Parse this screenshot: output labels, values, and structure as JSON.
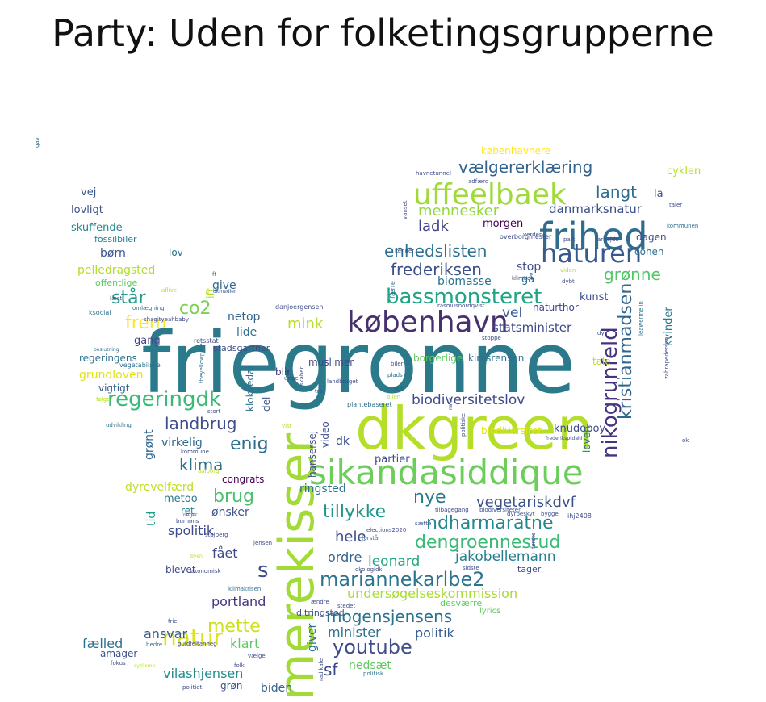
{
  "title": "Party: Uden for folketingsgrupperne",
  "words": [
    {
      "text": "friegronne",
      "color": "#2b7a8c"
    },
    {
      "text": "dkgreen",
      "color": "#b5de2b"
    },
    {
      "text": "sikandasiddique",
      "color": "#6ccd5a"
    },
    {
      "text": "merekisser",
      "color": "#a2da37"
    },
    {
      "text": "frihed",
      "color": "#2f6c8e"
    },
    {
      "text": "uffeelbaek",
      "color": "#9fda3a"
    },
    {
      "text": "københavn",
      "color": "#46306f"
    },
    {
      "text": "naturen",
      "color": "#38598c"
    },
    {
      "text": "regeringdk",
      "color": "#3aba76"
    },
    {
      "text": "natur",
      "color": "#dde318"
    },
    {
      "text": "bassmonsteret",
      "color": "#20a486"
    },
    {
      "text": "nikogrunfeld",
      "color": "#46337e"
    },
    {
      "text": "kristianmadsen",
      "color": "#31668e"
    },
    {
      "text": "youtube",
      "color": "#3e4c8a"
    },
    {
      "text": "mariannekarlbe2",
      "color": "#2c738e"
    },
    {
      "text": "dengroennestud",
      "color": "#3aba76"
    },
    {
      "text": "ndharmaratne",
      "color": "#24868e"
    },
    {
      "text": "tillykke",
      "color": "#1f968b"
    },
    {
      "text": "nye",
      "color": "#2a788e"
    },
    {
      "text": "vegetariskdvf",
      "color": "#3b528b"
    },
    {
      "text": "biodiversitetslov",
      "color": "#3e4a89"
    },
    {
      "text": "enhedslisten",
      "color": "#2c718e"
    },
    {
      "text": "frederiksen",
      "color": "#3c4f8a"
    },
    {
      "text": "grønne",
      "color": "#54c568"
    },
    {
      "text": "mennesker",
      "color": "#95d840"
    },
    {
      "text": "ladk",
      "color": "#414487"
    },
    {
      "text": "langt",
      "color": "#2e6d8e"
    },
    {
      "text": "vælgererklæring",
      "color": "#33628d"
    },
    {
      "text": "danmarksnatur",
      "color": "#3b518b"
    },
    {
      "text": "mink",
      "color": "#b8de29"
    },
    {
      "text": "co2",
      "color": "#7ad151"
    },
    {
      "text": "står",
      "color": "#1e9c89"
    },
    {
      "text": "frem",
      "color": "#fde725"
    },
    {
      "text": "mette",
      "color": "#cde11d"
    },
    {
      "text": "brug",
      "color": "#4ac16d"
    },
    {
      "text": "enig",
      "color": "#2e6e8e"
    },
    {
      "text": "klima",
      "color": "#2c728e"
    },
    {
      "text": "landbrug",
      "color": "#3d4e8a"
    },
    {
      "text": "s",
      "color": "#3e4a89"
    },
    {
      "text": "mogensjensens",
      "color": "#2c728e"
    },
    {
      "text": "hele",
      "color": "#3e4c8a"
    },
    {
      "text": "leonard",
      "color": "#21a685"
    },
    {
      "text": "jakobellemann",
      "color": "#277f8e"
    },
    {
      "text": "undersøgelseskommission",
      "color": "#a8db34"
    },
    {
      "text": "portland",
      "color": "#46337e"
    },
    {
      "text": "minister",
      "color": "#2d708e"
    },
    {
      "text": "politik",
      "color": "#365d8d"
    },
    {
      "text": "sf",
      "color": "#3f4889"
    },
    {
      "text": "nedsæt",
      "color": "#60ca60"
    },
    {
      "text": "ansvar",
      "color": "#375a8c"
    },
    {
      "text": "fælled",
      "color": "#2d718e"
    },
    {
      "text": "klart",
      "color": "#5ec962"
    },
    {
      "text": "vilashjensen",
      "color": "#228c8d"
    },
    {
      "text": "biden",
      "color": "#33638d"
    },
    {
      "text": "grøn",
      "color": "#3b518b"
    },
    {
      "text": "spolitik",
      "color": "#3e4a89"
    },
    {
      "text": "fået",
      "color": "#3f4889"
    },
    {
      "text": "blevet",
      "color": "#3e4c8a"
    },
    {
      "text": "ordre",
      "color": "#33638d"
    },
    {
      "text": "ringsted",
      "color": "#2d708e"
    },
    {
      "text": "dyrevelfærd",
      "color": "#bddf26"
    },
    {
      "text": "metoo",
      "color": "#2a788e"
    },
    {
      "text": "ønsker",
      "color": "#3b528b"
    },
    {
      "text": "ret",
      "color": "#26828e"
    },
    {
      "text": "tid",
      "color": "#1e9b8a"
    },
    {
      "text": "virkelig",
      "color": "#2f6b8e"
    },
    {
      "text": "grønt",
      "color": "#31688e"
    },
    {
      "text": "grundloven",
      "color": "#dfe318"
    },
    {
      "text": "gang",
      "color": "#414487"
    },
    {
      "text": "lide",
      "color": "#2e6f8e"
    },
    {
      "text": "netop",
      "color": "#33638d"
    },
    {
      "text": "give",
      "color": "#30698e"
    },
    {
      "text": "pelledragsted",
      "color": "#b2dd2d"
    },
    {
      "text": "børn",
      "color": "#3a548c"
    },
    {
      "text": "skuffende",
      "color": "#24878e"
    },
    {
      "text": "lovligt",
      "color": "#3b518b"
    },
    {
      "text": "vej",
      "color": "#38598c"
    },
    {
      "text": "lov",
      "color": "#2c728e"
    },
    {
      "text": "fossilbiler",
      "color": "#25848e"
    },
    {
      "text": "offentlige",
      "color": "#5ec962"
    },
    {
      "text": "regeringens",
      "color": "#2d708e"
    },
    {
      "text": "vigtigt",
      "color": "#365d8d"
    },
    {
      "text": "kvinder",
      "color": "#2a788e"
    },
    {
      "text": "kunst",
      "color": "#3b528b"
    },
    {
      "text": "tale",
      "color": "#bddf26"
    },
    {
      "text": "vel",
      "color": "#365d8d"
    },
    {
      "text": "naturthor",
      "color": "#3f4889"
    },
    {
      "text": "statsminister",
      "color": "#3e4a89"
    },
    {
      "text": "kirksrensen",
      "color": "#2d708e"
    },
    {
      "text": "borgerlige",
      "color": "#5ec962"
    },
    {
      "text": "biomasse",
      "color": "#2c728e"
    },
    {
      "text": "stop",
      "color": "#3e4c8a"
    },
    {
      "text": "gå",
      "color": "#2d708e"
    },
    {
      "text": "morgen",
      "color": "#440154"
    },
    {
      "text": "københavnere",
      "color": "#fde725"
    },
    {
      "text": "cyklen",
      "color": "#b5de2b"
    },
    {
      "text": "la",
      "color": "#3b528b"
    },
    {
      "text": "dagen",
      "color": "#3e4a89"
    },
    {
      "text": "cohen",
      "color": "#2e6e8e"
    },
    {
      "text": "knudoboy",
      "color": "#3e4c8a"
    },
    {
      "text": "loven",
      "color": "#2c728e"
    },
    {
      "text": "biodiversitet",
      "color": "#dde318"
    },
    {
      "text": "partier",
      "color": "#3e4a89"
    },
    {
      "text": "dk",
      "color": "#3b518b"
    },
    {
      "text": "video",
      "color": "#3e4c8a"
    },
    {
      "text": "hansersej",
      "color": "#3e4c8a"
    },
    {
      "text": "muslimer",
      "color": "#3f4889"
    },
    {
      "text": "klokkedal",
      "color": "#2d708e"
    },
    {
      "text": "del",
      "color": "#3b528b"
    },
    {
      "text": "blir",
      "color": "#46337e"
    },
    {
      "text": "giver",
      "color": "#2c728e"
    },
    {
      "text": "congrats",
      "color": "#440154"
    },
    {
      "text": "amager",
      "color": "#3b518b"
    },
    {
      "text": "ditringsted",
      "color": "#3e4c8a"
    },
    {
      "text": "desværre",
      "color": "#5ec962"
    },
    {
      "text": "lyrics",
      "color": "#5ec962"
    },
    {
      "text": "tager",
      "color": "#3e4a89"
    },
    {
      "text": "ift",
      "color": "#b5de2b"
    },
    {
      "text": "stadsgartner",
      "color": "#3e4c8a"
    },
    {
      "text": "retsstat",
      "color": "#3e4a89"
    },
    {
      "text": "danjoergensen",
      "color": "#3e4c8a"
    },
    {
      "text": "shagityeahbaby",
      "color": "#3e4c8a"
    },
    {
      "text": "omlægning",
      "color": "#2d708e"
    },
    {
      "text": "aflive",
      "color": "#b5de2b"
    },
    {
      "text": "læst",
      "color": "#3e4c8a"
    },
    {
      "text": "ft",
      "color": "#2d708e"
    },
    {
      "text": "ksocial",
      "color": "#2d708e"
    },
    {
      "text": "beslutning",
      "color": "#2c728e"
    },
    {
      "text": "vegetabilske",
      "color": "#2d708e"
    },
    {
      "text": "theyellowpete",
      "color": "#2d708e"
    },
    {
      "text": "følger",
      "color": "#b5de2b"
    },
    {
      "text": "udvikling",
      "color": "#2d708e"
    },
    {
      "text": "stort",
      "color": "#3e4c8a"
    },
    {
      "text": "vist",
      "color": "#b5de2b"
    },
    {
      "text": "unge",
      "color": "#3e4c8a"
    },
    {
      "text": "skaber",
      "color": "#3e4c8a"
    },
    {
      "text": "tro",
      "color": "#3e4c8a"
    },
    {
      "text": "landbruget",
      "color": "#3e4c8a"
    },
    {
      "text": "rasmusnordqvist",
      "color": "#3e4c8a"
    },
    {
      "text": "havnetunnel",
      "color": "#3e4c8a"
    },
    {
      "text": "adfærd",
      "color": "#3e4c8a"
    },
    {
      "text": "vanset",
      "color": "#3e4c8a"
    },
    {
      "text": "kender",
      "color": "#3e4c8a"
    },
    {
      "text": "verden",
      "color": "#3e4c8a"
    },
    {
      "text": "overborgmester",
      "color": "#3e4c8a"
    },
    {
      "text": "parti",
      "color": "#3e4c8a"
    },
    {
      "text": "arbejde",
      "color": "#3e4c8a"
    },
    {
      "text": "taler",
      "color": "#3e4c8a"
    },
    {
      "text": "kommunen",
      "color": "#2d708e"
    },
    {
      "text": "leawermelin",
      "color": "#2d708e"
    },
    {
      "text": "zahrapedersen",
      "color": "#3e4c8a"
    },
    {
      "text": "ihj2408",
      "color": "#3e4c8a"
    },
    {
      "text": "ok",
      "color": "#3e4c8a"
    },
    {
      "text": "frederiksptdahl",
      "color": "#3e4c8a"
    },
    {
      "text": "stm",
      "color": "#3e4c8a"
    },
    {
      "text": "plantebaseret",
      "color": "#2d708e"
    },
    {
      "text": "bilen",
      "color": "#b5de2b"
    },
    {
      "text": "nalut",
      "color": "#3e4c8a"
    },
    {
      "text": "politiske",
      "color": "#3e4c8a"
    },
    {
      "text": "biler",
      "color": "#3e4c8a"
    },
    {
      "text": "plads",
      "color": "#2d708e"
    },
    {
      "text": "stoppe",
      "color": "#3e4c8a"
    },
    {
      "text": "dyr",
      "color": "#3e4c8a"
    },
    {
      "text": "dybt",
      "color": "#3e4c8a"
    },
    {
      "text": "viden",
      "color": "#b5de2b"
    },
    {
      "text": "klimaet",
      "color": "#3e4c8a"
    },
    {
      "text": "færre",
      "color": "#2d708e"
    },
    {
      "text": "tilbagegang",
      "color": "#3e4c8a"
    },
    {
      "text": "biodiversiteten",
      "color": "#3e4c8a"
    },
    {
      "text": "sætte",
      "color": "#3e4c8a"
    },
    {
      "text": "dyrbeskyt",
      "color": "#3e4c8a"
    },
    {
      "text": "bygge",
      "color": "#3e4c8a"
    },
    {
      "text": "elections2020",
      "color": "#3e4c8a"
    },
    {
      "text": "forstår",
      "color": "#2d708e"
    },
    {
      "text": "første",
      "color": "#3e4c8a"
    },
    {
      "text": "okologidk",
      "color": "#3e4c8a"
    },
    {
      "text": "sidste",
      "color": "#3e4c8a"
    },
    {
      "text": "stedet",
      "color": "#3e4c8a"
    },
    {
      "text": "ændre",
      "color": "#3e4c8a"
    },
    {
      "text": "klimakrisen",
      "color": "#2d708e"
    },
    {
      "text": "jensen",
      "color": "#3e4c8a"
    },
    {
      "text": "støjberg",
      "color": "#3e4c8a"
    },
    {
      "text": "økonomisk",
      "color": "#3e4c8a"
    },
    {
      "text": "byen",
      "color": "#b5de2b"
    },
    {
      "text": "burhøns",
      "color": "#3e4c8a"
    },
    {
      "text": "neger",
      "color": "#3e4c8a"
    },
    {
      "text": "aalborg",
      "color": "#b5de2b"
    },
    {
      "text": "kommune",
      "color": "#3e4c8a"
    },
    {
      "text": "frie",
      "color": "#3e4c8a"
    },
    {
      "text": "bedre",
      "color": "#2d708e"
    },
    {
      "text": "guldfeltanneg",
      "color": "#3e4c8a"
    },
    {
      "text": "fokus",
      "color": "#3e4c8a"
    },
    {
      "text": "cyclisme",
      "color": "#b5de2b"
    },
    {
      "text": "folk",
      "color": "#3e4c8a"
    },
    {
      "text": "vælge",
      "color": "#3e4c8a"
    },
    {
      "text": "politiet",
      "color": "#3e4c8a"
    },
    {
      "text": "radikale",
      "color": "#3e4c8a"
    },
    {
      "text": "politisk",
      "color": "#2d708e"
    },
    {
      "text": "gav",
      "color": "#2d708e"
    },
    {
      "text": "dkmedier",
      "color": "#3e4c8a"
    }
  ]
}
